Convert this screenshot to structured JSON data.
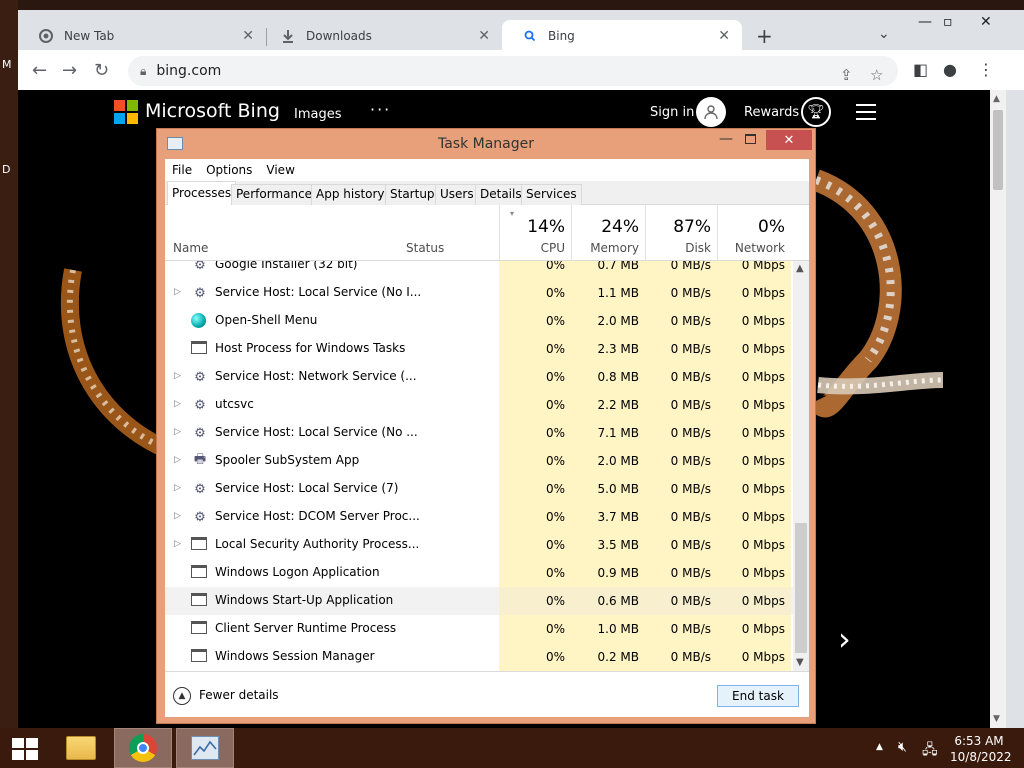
{
  "desktop": {
    "edge_letters": [
      "M",
      "D"
    ]
  },
  "browser": {
    "tabs": [
      {
        "label": "New Tab",
        "icon": "chrome-icon"
      },
      {
        "label": "Downloads",
        "icon": "download-icon"
      },
      {
        "label": "Bing",
        "icon": "search-icon",
        "active": true
      }
    ],
    "url": "bing.com"
  },
  "bing": {
    "brand": "Microsoft Bing",
    "nav_images": "Images",
    "nav_more": "···",
    "sign_in": "Sign in",
    "rewards": "Rewards",
    "logo_colors": [
      "#f25022",
      "#7fba00",
      "#00a4ef",
      "#ffb900"
    ]
  },
  "task_manager": {
    "title": "Task Manager",
    "menu": [
      "File",
      "Options",
      "View"
    ],
    "tabs": [
      "Processes",
      "Performance",
      "App history",
      "Startup",
      "Users",
      "Details",
      "Services"
    ],
    "active_tab": "Processes",
    "columns": {
      "name": "Name",
      "status": "Status",
      "cpu": {
        "percent": "14%",
        "label": "CPU"
      },
      "memory": {
        "percent": "24%",
        "label": "Memory"
      },
      "disk": {
        "percent": "87%",
        "label": "Disk"
      },
      "network": {
        "percent": "0%",
        "label": "Network"
      }
    },
    "processes": [
      {
        "name": "Google Installer (32 bit)",
        "icon": "installer-icon",
        "expandable": false,
        "cpu": "0%",
        "memory": "0.7 MB",
        "disk": "0 MB/s",
        "network": "0 Mbps"
      },
      {
        "name": "Service Host: Local Service (No I...",
        "icon": "gear-icon",
        "expandable": true,
        "cpu": "0%",
        "memory": "1.1 MB",
        "disk": "0 MB/s",
        "network": "0 Mbps"
      },
      {
        "name": "Open-Shell Menu",
        "icon": "shell-icon",
        "expandable": false,
        "cpu": "0%",
        "memory": "2.0 MB",
        "disk": "0 MB/s",
        "network": "0 Mbps"
      },
      {
        "name": "Host Process for Windows Tasks",
        "icon": "window-icon",
        "expandable": false,
        "cpu": "0%",
        "memory": "2.3 MB",
        "disk": "0 MB/s",
        "network": "0 Mbps"
      },
      {
        "name": "Service Host: Network Service (...",
        "icon": "gear-icon",
        "expandable": true,
        "cpu": "0%",
        "memory": "0.8 MB",
        "disk": "0 MB/s",
        "network": "0 Mbps"
      },
      {
        "name": "utcsvc",
        "icon": "gear-icon",
        "expandable": true,
        "cpu": "0%",
        "memory": "2.2 MB",
        "disk": "0 MB/s",
        "network": "0 Mbps"
      },
      {
        "name": "Service Host: Local Service (No ...",
        "icon": "gear-icon",
        "expandable": true,
        "cpu": "0%",
        "memory": "7.1 MB",
        "disk": "0 MB/s",
        "network": "0 Mbps"
      },
      {
        "name": "Spooler SubSystem App",
        "icon": "printer-icon",
        "expandable": true,
        "cpu": "0%",
        "memory": "2.0 MB",
        "disk": "0 MB/s",
        "network": "0 Mbps"
      },
      {
        "name": "Service Host: Local Service (7)",
        "icon": "gear-icon",
        "expandable": true,
        "cpu": "0%",
        "memory": "5.0 MB",
        "disk": "0 MB/s",
        "network": "0 Mbps"
      },
      {
        "name": "Service Host: DCOM Server Proc...",
        "icon": "gear-icon",
        "expandable": true,
        "cpu": "0%",
        "memory": "3.7 MB",
        "disk": "0 MB/s",
        "network": "0 Mbps"
      },
      {
        "name": "Local Security Authority Process...",
        "icon": "window-icon",
        "expandable": true,
        "cpu": "0%",
        "memory": "3.5 MB",
        "disk": "0 MB/s",
        "network": "0 Mbps"
      },
      {
        "name": "Windows Logon Application",
        "icon": "window-icon",
        "expandable": false,
        "cpu": "0%",
        "memory": "0.9 MB",
        "disk": "0 MB/s",
        "network": "0 Mbps"
      },
      {
        "name": "Windows Start-Up Application",
        "icon": "window-icon",
        "expandable": false,
        "cpu": "0%",
        "memory": "0.6 MB",
        "disk": "0 MB/s",
        "network": "0 Mbps",
        "highlighted": true
      },
      {
        "name": "Client Server Runtime Process",
        "icon": "window-icon",
        "expandable": false,
        "cpu": "0%",
        "memory": "1.0 MB",
        "disk": "0 MB/s",
        "network": "0 Mbps"
      },
      {
        "name": "Windows Session Manager",
        "icon": "window-icon",
        "expandable": false,
        "cpu": "0%",
        "memory": "0.2 MB",
        "disk": "0 MB/s",
        "network": "0 Mbps"
      }
    ],
    "fewer_details": "Fewer details",
    "end_task": "End task"
  },
  "taskbar": {
    "items": [
      "file-explorer-icon",
      "chrome-icon",
      "task-manager-icon"
    ],
    "time": "6:53 AM",
    "date": "10/8/2022"
  }
}
